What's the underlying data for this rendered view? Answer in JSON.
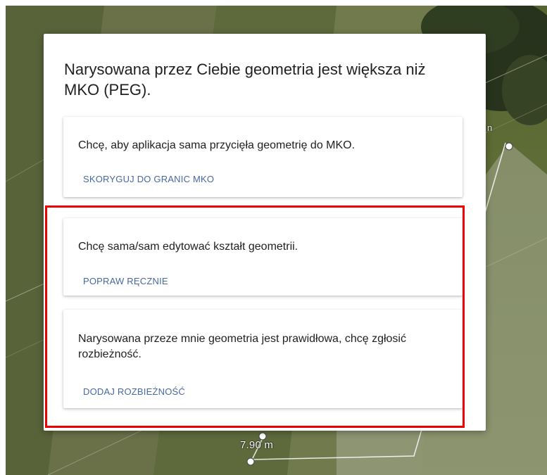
{
  "map": {
    "measurement_label": "7.90 m",
    "edge_fragment_text": "n"
  },
  "dialog": {
    "title": "Narysowana przez Ciebie geometria jest większa niż MKO (PEG).",
    "options": [
      {
        "description": "Chcę, aby aplikacja sama przycięła geometrię do MKO.",
        "action_label": "SKORYGUJ DO GRANIC MKO"
      },
      {
        "description": "Chcę sama/sam edytować kształt geometrii.",
        "action_label": "POPRAW RĘCZNIE"
      },
      {
        "description": "Narysowana przeze mnie geometria jest prawidłowa, chcę zgłosić rozbieżność.",
        "action_label": "DODAJ ROZBIEŻNOŚĆ"
      }
    ]
  },
  "colors": {
    "action_text": "#46689f",
    "highlight_border": "#ee0000",
    "dialog_background": "#ffffff"
  }
}
